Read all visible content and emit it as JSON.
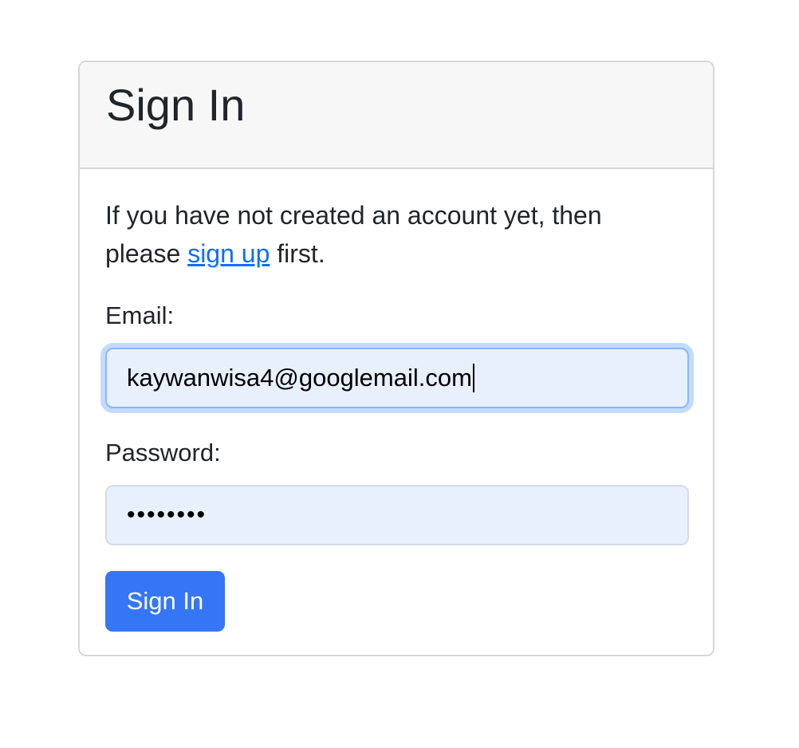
{
  "card": {
    "title": "Sign In"
  },
  "intro": {
    "text_before": "If you have not created an account yet, then please ",
    "link_label": "sign up",
    "text_after": " first."
  },
  "form": {
    "email_label": "Email:",
    "email_value": "kaywanwisa4@googlemail.com",
    "password_label": "Password:",
    "password_mask": "••••••••",
    "submit_label": "Sign In"
  },
  "colors": {
    "primary": "#3576f6",
    "link": "#0d6efd",
    "input_autofill_bg": "#e8f0fe",
    "header_bg": "#f7f7f7"
  }
}
